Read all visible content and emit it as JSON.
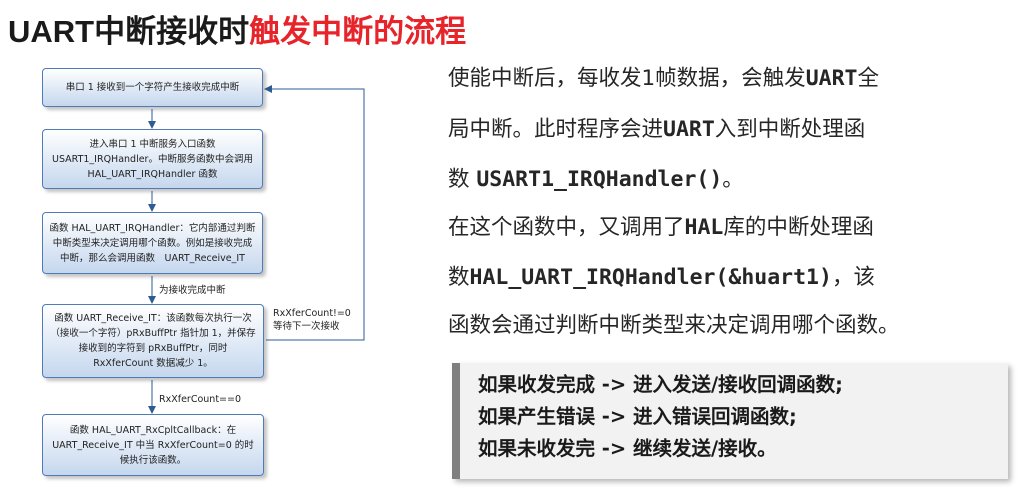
{
  "title": {
    "part1": "UART中断接收时",
    "part2": "触发中断的流程",
    "accent_color": "#e8242b"
  },
  "flowchart": {
    "box1": "串口 1 接收到一个字符产生接收完成中断",
    "box2": "进入串口 1 中断服务入口函数 USART1_IRQHandler。中断服务函数中会调用 HAL_UART_IRQHandler 函数",
    "box3": "函数 HAL_UART_IRQHandler：它内部通过判断中断类型来决定调用哪个函数。例如是接收完成中断，那么会调用函数　UART_Receive_IT",
    "edge3_label": "为接收完成中断",
    "box4": "函数 UART_Receive_IT：该函数每次执行一次（接收一个字符）pRxBuffPtr 指针加 1，并保存接收到的字符到 pRxBuffPtr，同时 RxXferCount 数据减少 1。",
    "loop_label_1": "RxXferCount!=0",
    "loop_label_2": "等待下一次接收",
    "edge4_label": "RxXferCount==0",
    "box5": "函数 HAL_UART_RxCpltCallback：在 UART_Receive_IT 中当 RxXferCount=0 的时候执行该函数。"
  },
  "description": {
    "line1a": "使能中断后，每收发1帧数据，会触发",
    "line1b": "UART",
    "line1c": "全",
    "line2a": "局中断。此时程序会进",
    "line2b": "UART",
    "line2c": "入到中断处理函",
    "line3a": "数 ",
    "line3b": "USART1_IRQHandler()",
    "line3c": "。",
    "line4a": "在这个函数中，又调用了",
    "line4b": "HAL",
    "line4c": "库的中断处理函",
    "line5a": "数",
    "line5b": "HAL_UART_IRQHandler(&huart1)",
    "line5c": "，该",
    "line6": "函数会通过判断中断类型来决定调用哪个函数。"
  },
  "callout": {
    "line1": "如果收发完成 -> 进入发送/接收回调函数;",
    "line2": "如果产生错误 -> 进入错误回调函数;",
    "line3": "如果未收发完 -> 继续发送/接收。"
  }
}
